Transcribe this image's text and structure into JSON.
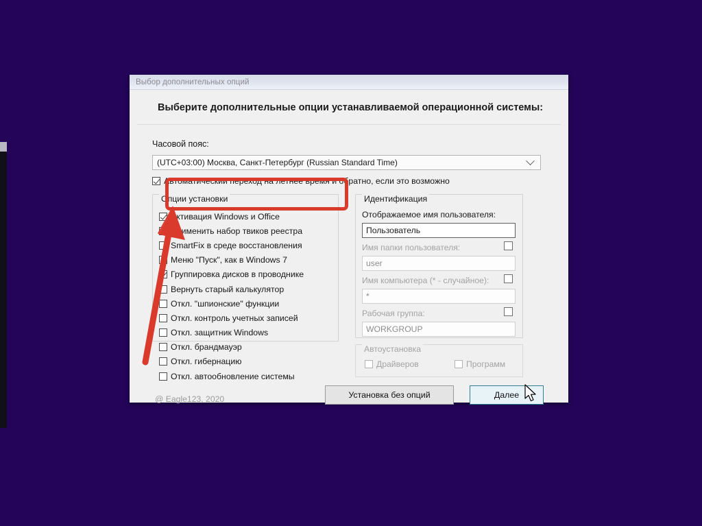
{
  "window": {
    "titlebar": "Выбор дополнительных опций",
    "header": "Выберите дополнительные опции устанавливаемой операционной системы:"
  },
  "timezone": {
    "label": "Часовой пояс:",
    "selected": "(UTC+03:00) Москва, Санкт-Петербург (Russian Standard Time)",
    "dst_label": "Автоматический переход на летнее время и обратно, если это возможно",
    "dst_checked": true
  },
  "options_group": {
    "legend": "Опции установки",
    "items": [
      {
        "label": "Активация Windows и Office",
        "checked": true
      },
      {
        "label": "Применить набор твиков реестра",
        "checked": false
      },
      {
        "label": "SmartFix в среде восстановления",
        "checked": false
      },
      {
        "label": "Меню \"Пуск\", как в Windows 7",
        "checked": false
      },
      {
        "label": "Группировка дисков в проводнике",
        "checked": true
      },
      {
        "label": "Вернуть старый калькулятор",
        "checked": false
      },
      {
        "label": "Откл. \"шпионские\" функции",
        "checked": false
      },
      {
        "label": "Откл. контроль учетных записей",
        "checked": false
      },
      {
        "label": "Откл. защитник Windows",
        "checked": false
      },
      {
        "label": "Откл. брандмауэр",
        "checked": false
      },
      {
        "label": "Откл. гибернацию",
        "checked": false
      },
      {
        "label": "Откл. автообновление системы",
        "checked": false
      }
    ]
  },
  "identification": {
    "legend": "Идентификация",
    "display_name_label": "Отображаемое имя пользователя:",
    "display_name_value": "Пользователь",
    "folder_name_label": "Имя папки пользователя:",
    "folder_name_value": "user",
    "computer_name_label": "Имя компьютера (* - случайное):",
    "computer_name_value": "*",
    "workgroup_label": "Рабочая группа:",
    "workgroup_value": "WORKGROUP"
  },
  "autoinstall": {
    "legend": "Автоустановка",
    "drivers_label": "Драйверов",
    "drivers_checked": false,
    "programs_label": "Программ",
    "programs_checked": false
  },
  "footer": {
    "copyright": "@ Eagle123, 2020",
    "btn_no_options": "Установка без опций",
    "btn_next": "Далее"
  },
  "annotation": {
    "highlight_color": "#d93a2b",
    "arrow_color": "#d93a2b"
  },
  "colors": {
    "desktop_background": "#230458",
    "dialog_background": "#f0f0f0",
    "titlebar_gradient_top": "#d7dcea",
    "focus_border": "#2e7f96"
  }
}
